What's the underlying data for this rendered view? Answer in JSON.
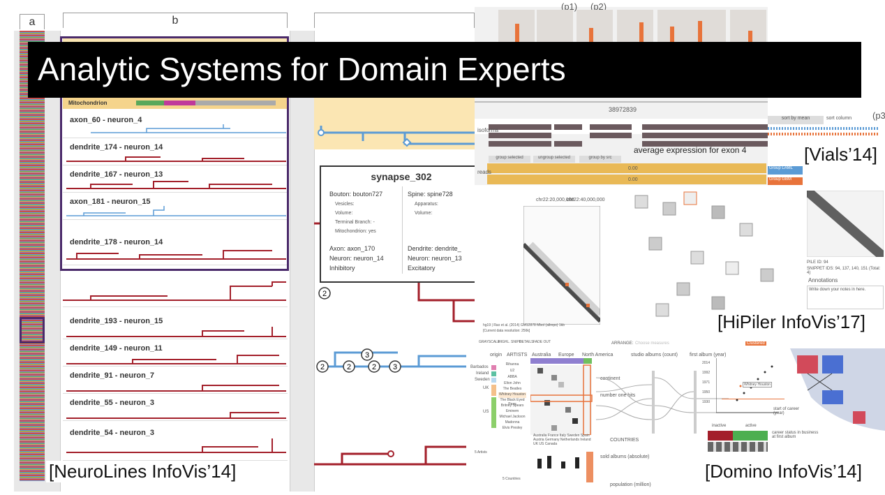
{
  "title": "Analytic Systems for Domain Experts",
  "neurolines": {
    "caption": "[NeuroLines InfoVis’14]",
    "col_a": "a",
    "col_b": "b",
    "mito_label": "Mitochondrion",
    "rows": [
      "axon_60 - neuron_4",
      "dendrite_174 - neuron_14",
      "dendrite_167 - neuron_13",
      "axon_181 - neuron_15",
      "dendrite_178 - neuron_14",
      "dendrite_193 - neuron_15",
      "dendrite_149 - neuron_11",
      "dendrite_91 - neuron_7",
      "dendrite_55 - neuron_3",
      "dendrite_54 - neuron_3"
    ],
    "tooltip": {
      "title": "synapse_302",
      "bouton_label": "Bouton:",
      "bouton_value": "bouton727",
      "spine_label": "Spine:",
      "spine_value": "spine728",
      "vesicles": "Vesicles:",
      "apparatus": "Apparatus:",
      "volume1": "Volume:",
      "volume2": "Volume:",
      "terminal": "Terminal Branch: -",
      "mito": "Mitochondrion: yes",
      "axon_label": "Axon:",
      "axon_value": "axon_170",
      "neuron1_label": "Neuron:",
      "neuron1_value": "neuron_14",
      "inhibitory": "Inhibitory",
      "dendrite_label": "Dendrite:",
      "dendrite_value": "dendrite_",
      "neuron2_label": "Neuron:",
      "neuron2_value": "neuron_13",
      "excitatory": "Excitatory"
    },
    "badges": [
      "2",
      "2",
      "3",
      "2",
      "2",
      "3"
    ]
  },
  "vials": {
    "caption": "[Vials’14]",
    "p1": "(p1)",
    "p2": "(p2)",
    "p3": "(p3",
    "annotation": "average expression for exon 4",
    "sort_by_mean": "sort by mean",
    "sort_column": "sort column",
    "group_selected": "group selected",
    "ungroup_selected": "ungroup selected",
    "group_by_src": "group by src",
    "group_laml": "Group LAML",
    "group_gbm": "Group GBM",
    "isoforms": "isoforms",
    "reads": "reads",
    "value": "0.00",
    "position": "38972839"
  },
  "hipiler": {
    "caption": "[HiPiler InfoVis’17]",
    "chr_label1": "chr22:20,000,000",
    "chr_label2": "chr22:40,000,000",
    "pile_id": "PILE ID: 94",
    "snippet_ids": "SNIPPET IDS: 94, 137, 140, 151 (Total: 4)",
    "annotations": "Annotations",
    "notes_placeholder": "Write down your notes in here.",
    "footer": "hg19 | Rao et al. (2014) GM12878 Mbol (allreps) 1kb",
    "resolution": "[Current data resolution: 256k]",
    "arrange": "ARRANGE:",
    "choose": "Choose measures",
    "clustered": "Clustered",
    "grayscale": "GRAYSCALE",
    "highl": "HIGHL. SNIPP.",
    "details": "DETAILS",
    "fade_out": "FADE OUT"
  },
  "domino": {
    "caption": "[Domino InfoVis’14]",
    "origin": "origin",
    "artists": "ARTISTS",
    "australia": "Australia",
    "europe": "Europe",
    "north_america": "North America",
    "studio_albums": "studio albums (count)",
    "first_album": "first album (year)",
    "continent": "continent",
    "number_one_hits": "number one hits",
    "countries_label": "COUNTRIES",
    "sold_albums": "sold albums (absolute)",
    "population": "population (million)",
    "start_of_career": "start of career (year)",
    "inactive": "inactive",
    "active": "active",
    "career_status": "career status in business at first album",
    "origins": [
      "Barbados",
      "Ireland",
      "Sweden",
      "UK",
      "US"
    ],
    "artist_list": [
      "Rihanna",
      "U2",
      "ABBA",
      "Elton John",
      "The Beatles",
      "Whitney Houston",
      "The Black Eyed Peas",
      "Britney Spears",
      "Eminem",
      "Michael Jackson",
      "Madonna",
      "Elvis Presley"
    ],
    "countries": [
      "Australia",
      "France",
      "Italy",
      "Sweden",
      "Spain",
      "Austria",
      "Germany",
      "Netherlands",
      "Ireland",
      "UK",
      "US",
      "Canada"
    ],
    "five_artists": "5 Artists",
    "five_countries": "5 Countries",
    "tooltip": "Whitney Houston",
    "years": [
      "1930",
      "1950",
      "1971",
      "1992",
      "2014"
    ]
  },
  "colors": {
    "banner": "#000000",
    "neuron_red": "#a31f2a",
    "neuron_blue": "#5b9bd5",
    "purple": "#4a2a6a",
    "yellow": "#fbe6b3",
    "orange": "#e8733a"
  }
}
